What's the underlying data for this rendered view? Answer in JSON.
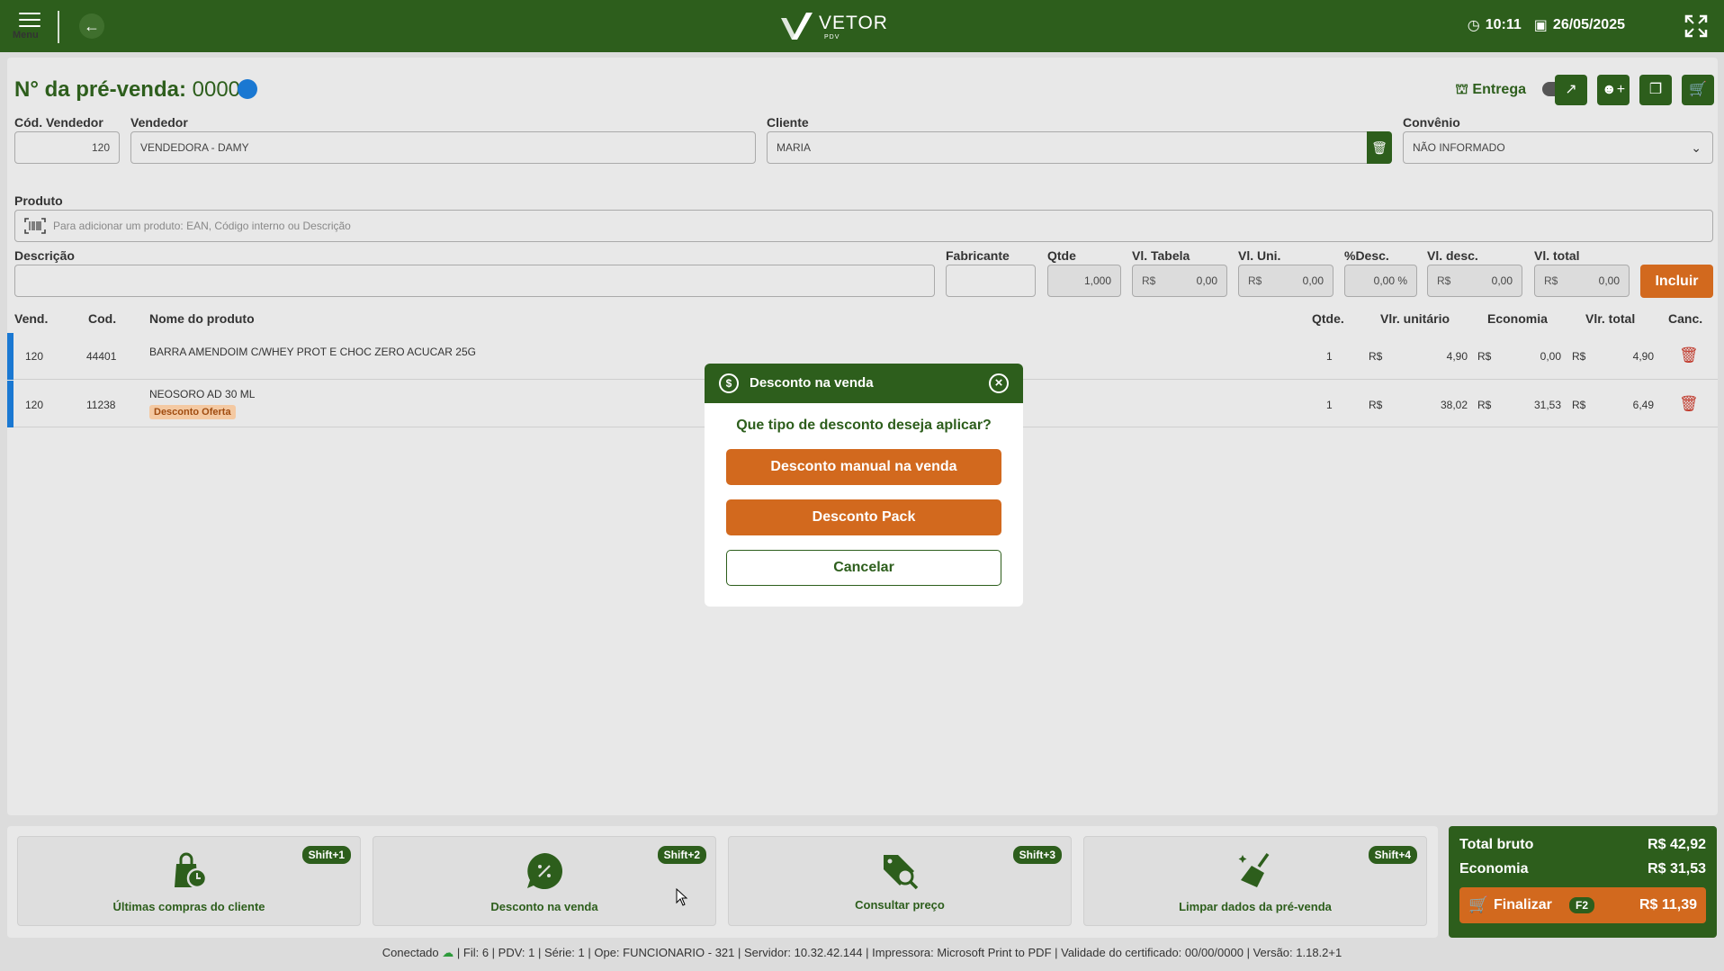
{
  "topbar": {
    "menu_label": "Menu",
    "logo_text": "VETOR",
    "logo_sub": "PDV",
    "time": "10:11",
    "date": "26/05/2025",
    "icons": [
      "menu-icon",
      "arrow-left-icon",
      "clock-icon",
      "calendar-icon",
      "fullscreen-icon"
    ]
  },
  "header": {
    "title": "N° da pré-venda:",
    "number": "0000",
    "delivery_label": "Entrega",
    "delivery_enabled": false,
    "status_color": "#1a78d2"
  },
  "form": {
    "cod_vendedor_label": "Cód. Vendedor",
    "cod_vendedor_value": "120",
    "vendedor_label": "Vendedor",
    "vendedor_value": "VENDEDORA - DAMY",
    "cliente_label": "Cliente",
    "cliente_value": "MARIA",
    "convenio_label": "Convênio",
    "convenio_value": "NÃO INFORMADO",
    "produto_label": "Produto",
    "produto_placeholder": "Para adicionar um produto: EAN, Código interno ou Descrição",
    "descricao_label": "Descrição",
    "fabricante_label": "Fabricante",
    "qtde_label": "Qtde",
    "qtde_value": "1,000",
    "vl_tabela_label": "Vl. Tabela",
    "vl_uni_label": "Vl. Uni.",
    "pct_desc_label": "%Desc.",
    "vl_desc_label": "Vl. desc.",
    "vl_total_label": "Vl. total",
    "currency": "R$",
    "zero": "0,00",
    "pct_value": "0,00 %",
    "incluir_label": "Incluir"
  },
  "table": {
    "headers": {
      "vend": "Vend.",
      "cod": "Cod.",
      "nome": "Nome do produto",
      "qtde": "Qtde.",
      "unit": "Vlr. unitário",
      "eco": "Economia",
      "total": "Vlr. total",
      "canc": "Canc."
    },
    "currency": "R$",
    "rows": [
      {
        "vend": "120",
        "cod": "44401",
        "nome": "BARRA AMENDOIM C/WHEY PROT E CHOC ZERO ACUCAR 25G",
        "badge": "",
        "qtde": "1",
        "unit": "4,90",
        "eco": "0,00",
        "total": "4,90"
      },
      {
        "vend": "120",
        "cod": "11238",
        "nome": "NEOSORO AD 30 ML",
        "badge": "Desconto Oferta",
        "qtde": "1",
        "unit": "38,02",
        "eco": "31,53",
        "total": "6,49"
      }
    ]
  },
  "modal": {
    "title": "Desconto na venda",
    "question": "Que tipo de desconto deseja aplicar?",
    "btn_manual": "Desconto manual na venda",
    "btn_pack": "Desconto Pack",
    "btn_cancel": "Cancelar"
  },
  "actions": [
    {
      "label": "Últimas compras do cliente",
      "shortcut": "Shift+1",
      "icon": "purchase-history-icon"
    },
    {
      "label": "Desconto na venda",
      "shortcut": "Shift+2",
      "icon": "discount-icon"
    },
    {
      "label": "Consultar preço",
      "shortcut": "Shift+3",
      "icon": "price-search-icon"
    },
    {
      "label": "Limpar dados da pré-venda",
      "shortcut": "Shift+4",
      "icon": "broom-icon"
    }
  ],
  "totals": {
    "bruto_label": "Total bruto",
    "bruto_value": "R$ 42,92",
    "economia_label": "Economia",
    "economia_value": "R$ 31,53",
    "finalizar_label": "Finalizar",
    "finalizar_key": "F2",
    "finalizar_value": "R$ 11,39"
  },
  "status": {
    "conectado": "Conectado",
    "details": "| Fil: 6 | PDV: 1 | Série: 1 | Ope: FUNCIONARIO - 321 | Servidor: 10.32.42.144 | Impressora: Microsoft Print to PDF | Validade do certificado: 00/00/0000 | Versão: 1.18.2+1"
  },
  "colors": {
    "primary": "#2d5e1c",
    "accent": "#d2691e",
    "danger": "#c0392b",
    "info": "#1a78d2"
  }
}
